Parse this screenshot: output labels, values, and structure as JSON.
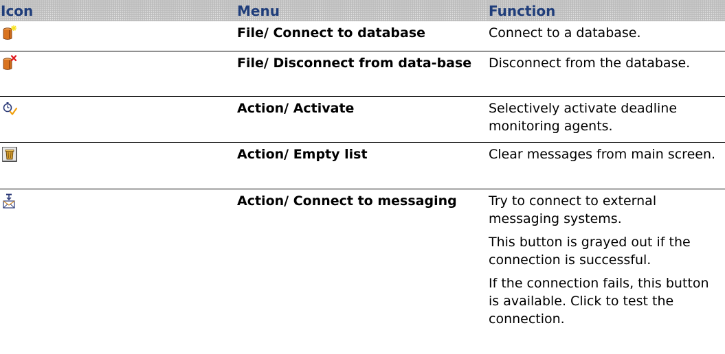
{
  "table": {
    "headers": {
      "icon": "Icon",
      "menu": "Menu",
      "function": "Function"
    },
    "header_color": "#1f3d7a",
    "header_background": "#bdbdbd",
    "rows": [
      {
        "icon": "connect-database-icon",
        "menu": "File/ Connect to database",
        "function": [
          "Connect to a database."
        ]
      },
      {
        "icon": "disconnect-database-icon",
        "menu": "File/ Disconnect from data-base",
        "function": [
          "Disconnect from the database."
        ]
      },
      {
        "icon": "activate-agents-icon",
        "menu": "Action/ Activate",
        "function": [
          "Selectively activate deadline monitoring agents."
        ]
      },
      {
        "icon": "empty-list-icon",
        "menu": "Action/ Empty list",
        "function": [
          "Clear messages from main screen."
        ]
      },
      {
        "icon": "connect-messaging-icon",
        "menu": "Action/ Connect to messaging",
        "function": [
          "Try to connect to external messaging systems.",
          "This button is grayed out if the connection is successful.",
          "If the connection fails, this button is available. Click to test the connection."
        ]
      }
    ]
  }
}
